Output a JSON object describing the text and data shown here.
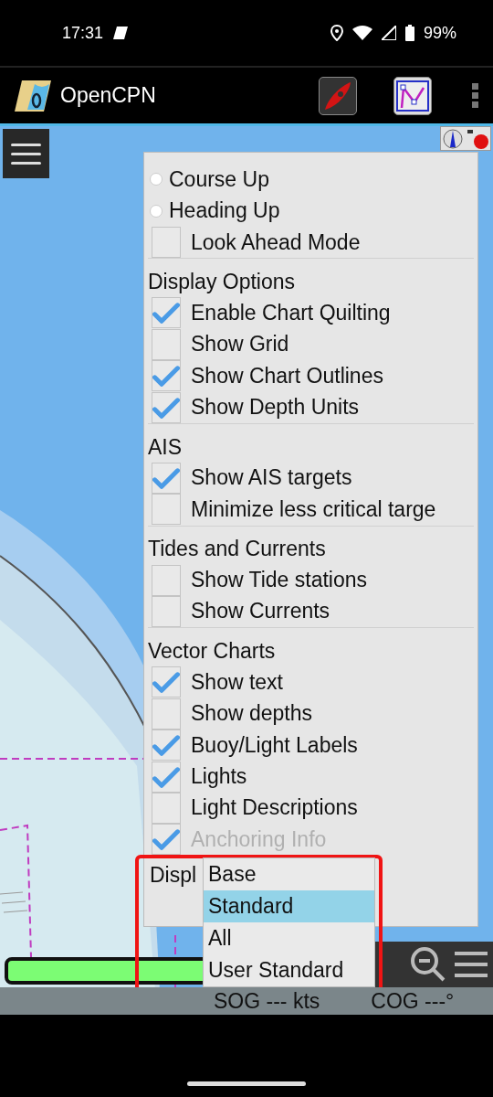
{
  "status_bar": {
    "time": "17:31",
    "battery": "99%"
  },
  "app_bar": {
    "title": "OpenCPN"
  },
  "options": {
    "orientation": [
      {
        "label": "Course Up",
        "selected": false
      },
      {
        "label": "Heading Up",
        "selected": false
      }
    ],
    "look_ahead": {
      "label": "Look Ahead Mode",
      "checked": false
    },
    "sections": [
      {
        "title": "Display Options",
        "items": [
          {
            "label": "Enable Chart Quilting",
            "checked": true,
            "disabled": false
          },
          {
            "label": "Show Grid",
            "checked": false,
            "disabled": false
          },
          {
            "label": "Show Chart Outlines",
            "checked": true,
            "disabled": false
          },
          {
            "label": "Show Depth Units",
            "checked": true,
            "disabled": false
          }
        ]
      },
      {
        "title": "AIS",
        "items": [
          {
            "label": "Show AIS targets",
            "checked": true,
            "disabled": false
          },
          {
            "label": "Minimize less critical targe",
            "checked": false,
            "disabled": false
          }
        ]
      },
      {
        "title": "Tides and Currents",
        "items": [
          {
            "label": "Show Tide stations",
            "checked": false,
            "disabled": false
          },
          {
            "label": "Show Currents",
            "checked": false,
            "disabled": false
          }
        ]
      },
      {
        "title": "Vector Charts",
        "items": [
          {
            "label": "Show text",
            "checked": true,
            "disabled": false
          },
          {
            "label": "Show depths",
            "checked": false,
            "disabled": false
          },
          {
            "label": "Buoy/Light Labels",
            "checked": true,
            "disabled": false
          },
          {
            "label": "Lights",
            "checked": true,
            "disabled": false
          },
          {
            "label": "Light Descriptions",
            "checked": false,
            "disabled": false
          },
          {
            "label": "Anchoring Info",
            "checked": true,
            "disabled": true
          }
        ]
      }
    ],
    "display_category": {
      "label": "Displ",
      "options": [
        {
          "label": "Base",
          "selected": false
        },
        {
          "label": "Standard",
          "selected": true
        },
        {
          "label": "All",
          "selected": false
        },
        {
          "label": "User Standard",
          "selected": false
        }
      ]
    }
  },
  "nav_info": {
    "sog": "SOG --- kts",
    "cog": "COG ---°"
  }
}
